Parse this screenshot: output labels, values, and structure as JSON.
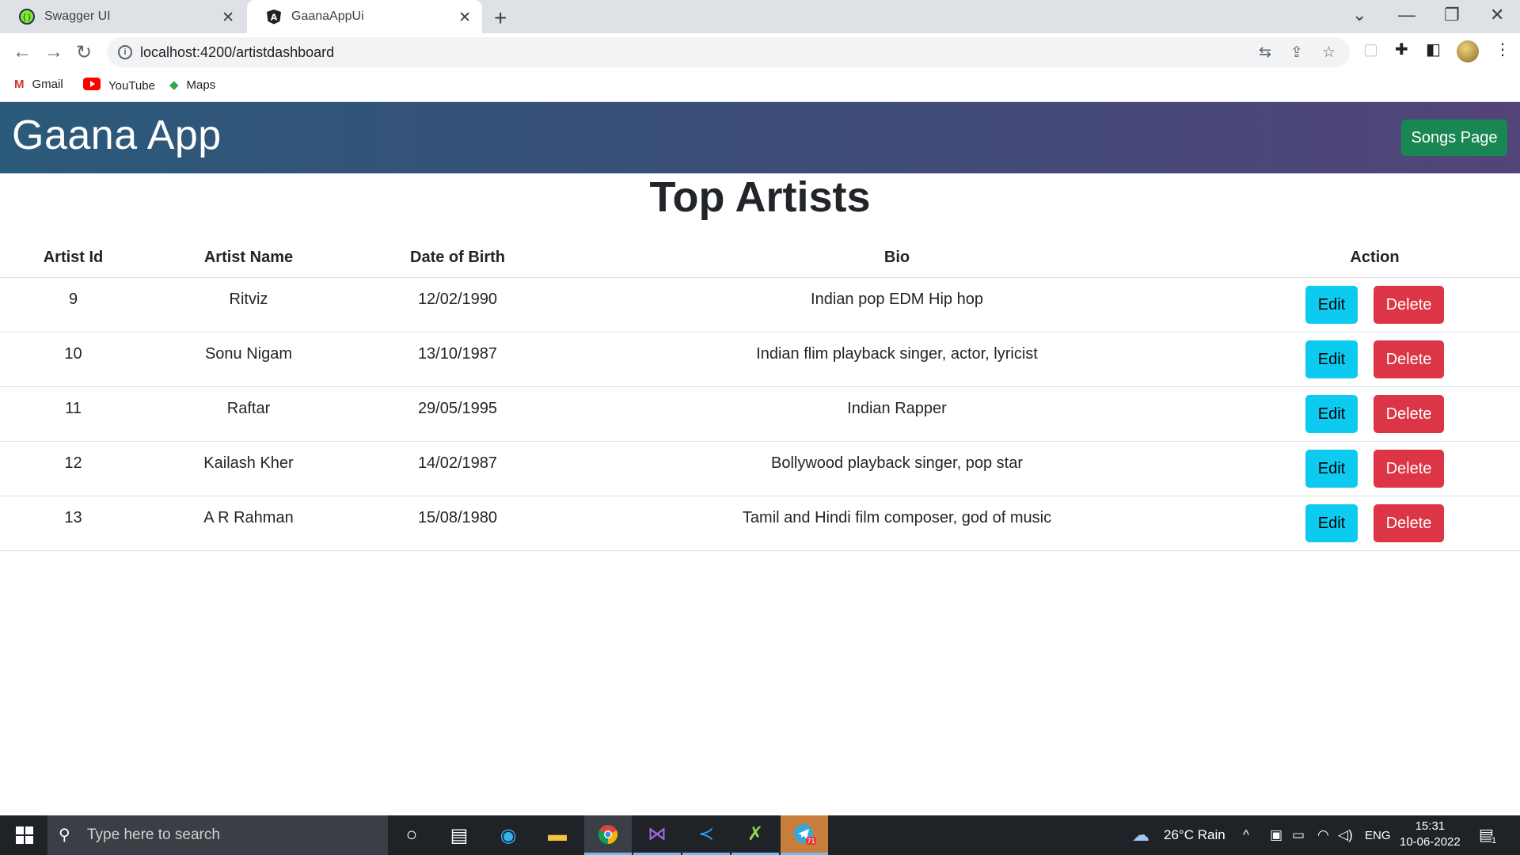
{
  "browser": {
    "tabs": [
      {
        "title": "Swagger UI",
        "icon": "swagger-icon"
      },
      {
        "title": "GaanaAppUi",
        "icon": "angular-icon"
      }
    ],
    "url": "localhost:4200/artistdashboard",
    "bookmarks": [
      {
        "label": "Gmail",
        "icon": "gmail-icon"
      },
      {
        "label": "YouTube",
        "icon": "youtube-icon"
      },
      {
        "label": "Maps",
        "icon": "maps-icon"
      }
    ]
  },
  "app": {
    "brand": "Gaana App",
    "songs_button": "Songs Page",
    "page_title": "Top Artists",
    "columns": [
      "Artist Id",
      "Artist Name",
      "Date of Birth",
      "Bio",
      "Action"
    ],
    "artists": [
      {
        "id": "9",
        "name": "Ritviz",
        "dob": "12/02/1990",
        "bio": "Indian pop EDM Hip hop"
      },
      {
        "id": "10",
        "name": "Sonu Nigam",
        "dob": "13/10/1987",
        "bio": "Indian flim playback singer, actor, lyricist"
      },
      {
        "id": "11",
        "name": "Raftar",
        "dob": "29/05/1995",
        "bio": "Indian Rapper"
      },
      {
        "id": "12",
        "name": "Kailash Kher",
        "dob": "14/02/1987",
        "bio": "Bollywood playback singer, pop star"
      },
      {
        "id": "13",
        "name": "A R Rahman",
        "dob": "15/08/1980",
        "bio": "Tamil and Hindi film composer, god of music"
      }
    ],
    "edit_label": "Edit",
    "delete_label": "Delete",
    "colors": {
      "edit": "#0dcaf0",
      "delete": "#dc3545",
      "songs": "#198754"
    }
  },
  "taskbar": {
    "search_placeholder": "Type here to search",
    "weather": "26°C  Rain",
    "language": "ENG",
    "time": "15:31",
    "date": "10-06-2022",
    "notification_count": "1",
    "telegram_badge": "71"
  }
}
